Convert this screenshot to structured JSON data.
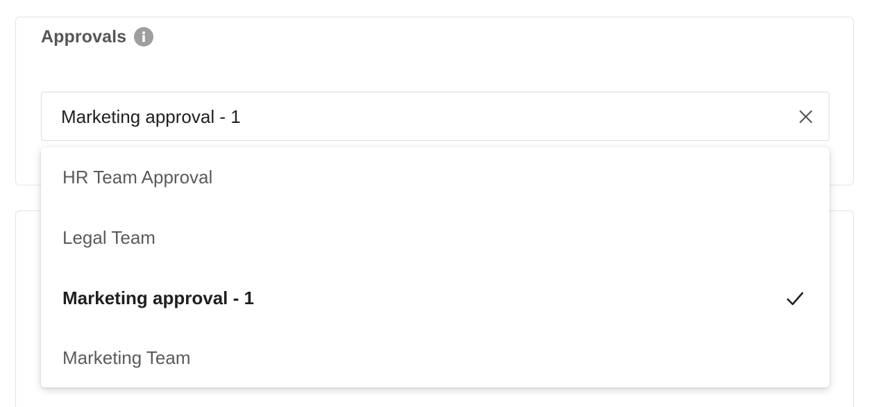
{
  "approvals": {
    "heading": "Approvals",
    "info_icon": "info-icon",
    "selected_value": "Marketing approval - 1",
    "clear_icon": "close-icon",
    "options": [
      {
        "label": "HR Team Approval",
        "selected": false
      },
      {
        "label": "Legal Team",
        "selected": false
      },
      {
        "label": "Marketing approval - 1",
        "selected": true
      },
      {
        "label": "Marketing Team",
        "selected": false
      }
    ],
    "check_icon": "check-icon"
  },
  "colors": {
    "heading": "#555555",
    "info_icon_bg": "#9e9e9e",
    "option_text": "#5a5a5a",
    "selected_text": "#1f1f1f",
    "border": "#dcdcdc"
  }
}
